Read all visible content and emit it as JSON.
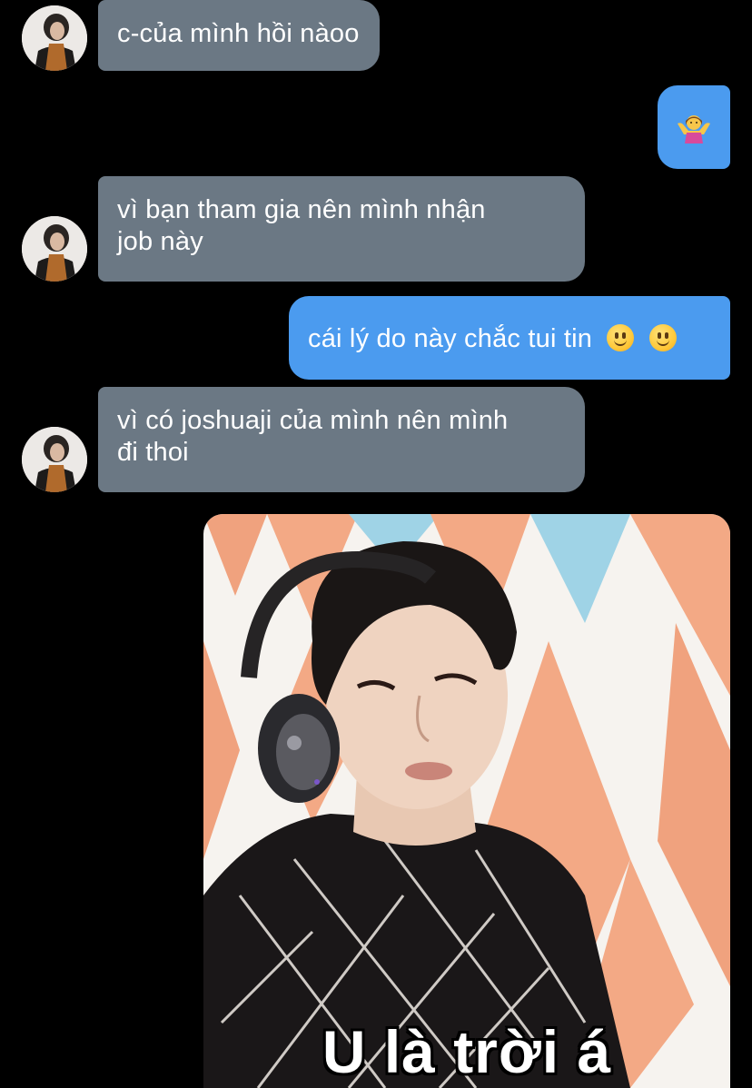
{
  "conversation": {
    "messages": [
      {
        "direction": "incoming",
        "text": "c-của mình hồi nàoo"
      },
      {
        "direction": "outgoing",
        "emoji": "person-shrugging-emoji"
      },
      {
        "direction": "incoming",
        "line1": "vì bạn tham gia nên mình nhận",
        "line2": "job này"
      },
      {
        "direction": "outgoing",
        "text": "cái lý do này chắc tui tin",
        "emoji": "slightly-smiling-face-emoji",
        "emoji_count": 2
      },
      {
        "direction": "incoming",
        "line1": "vì có joshuaji của mình nên mình",
        "line2": "đi thoi"
      },
      {
        "direction": "outgoing",
        "type": "image-meme",
        "caption": "U là trời á"
      }
    ]
  },
  "colors": {
    "background": "#000000",
    "incoming_bubble": "#6b7884",
    "outgoing_bubble": "#4b9bef",
    "text": "#ffffff"
  }
}
